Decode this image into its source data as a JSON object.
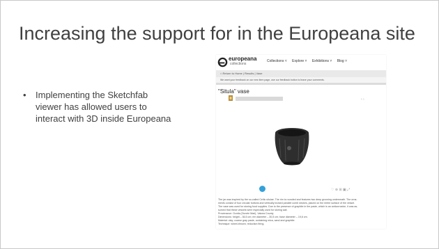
{
  "slide": {
    "title": "Increasing the support for in the Europeana site",
    "bullet_symbol": "•",
    "bullet_text": "Implementing the Sketchfab viewer has allowed users to interact with 3D inside Europeana"
  },
  "screenshot": {
    "brand": "europeana",
    "brand_sub": "collections",
    "nav": [
      "Collections ˅",
      "Explore ˅",
      "Exhibitions ˅",
      "Blog ˅"
    ],
    "breadcrumb": "⌂ Return to Home  |  Results  |  Vase",
    "feedback": "We want your feedback on our new item page, use our feedback button to leave your comments.",
    "item_title": "\"Situla\" vase",
    "arrows": "‹  ›",
    "tools": "♡  ⊕  ⊞  ▣  ⤢",
    "description": [
      "The jar was inspired by the so-called Celtic situlae. The rim is rounded and features two deep grooving underneath. The orna-",
      "ments consist of four circular buttons and vertically incised parallel comb strokes, placed on the entire surface of the vessel.",
      "The vase was used for storing food supplies. Due to the presence of graphite in the paste, which is an anticorrosive, it was as-",
      "sumed that these vessels were especially used for storing salt.",
      "Provenance: Ocnita (Ocnele Mari), Valcea County",
      "Dimensions: height – 36,5 cm; rim diameter – 30,5 cm; base diameter – 19,6 cm.",
      "Material: clay; coarse gray paste, containing mica, sand and graphite.",
      "Technique: wheel-thrown; reduction firing."
    ],
    "accent_color": "#35a1d9"
  }
}
